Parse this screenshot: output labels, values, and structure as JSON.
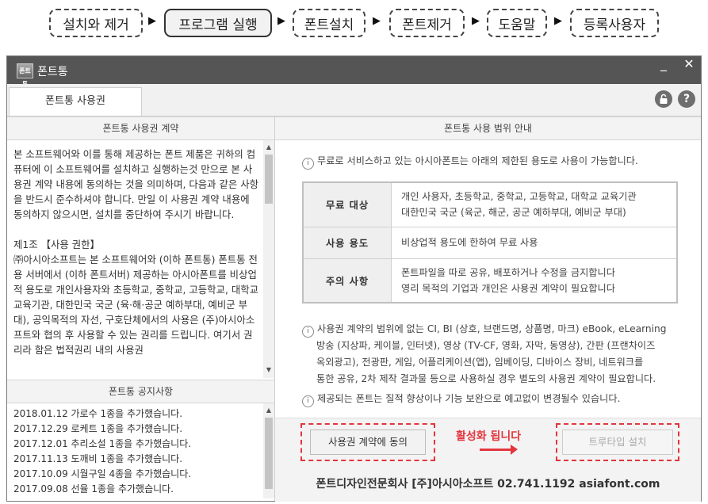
{
  "steps": [
    "설치와 제거",
    "프로그램 실행",
    "폰트설치",
    "폰트제거",
    "도움말",
    "등록사용자"
  ],
  "active_step": "프로그램 실행",
  "window": {
    "icon_text": "폰트통",
    "title": "폰트통",
    "minimize_glyph": "_",
    "close_glyph": "✕"
  },
  "tab": {
    "label": "폰트통 사용권"
  },
  "left": {
    "license_header": "폰트통 사용권 계약",
    "license_paragraphs": [
      "본 소프트웨어와 이를 통해 제공하는 폰트 제품은 귀하의 컴퓨터에 이 소프트웨어를 설치하고 실행하는것 만으로 본 사용권 계약 내용에 동의하는 것을 의미하며, 다음과 같은 사항을 반드시 준수하셔야 합니다. 만일 이 사용권 계약 내용에 동의하지 않으시면, 설치를 중단하여 주시기 바랍니다.",
      "제1조 【사용 권한】\n㈜아시아소프트는 본 소프트웨어와 (이하 폰트통) 폰트통 전용 서버에서 (이하 폰트서버) 제공하는 아시아폰트를 비상업적 용도로 개인사용자와 초등학교, 중학교, 고등학교, 대학교 교육기관, 대한민국 국군 (육·해·공군 예하부대, 예비군 부대), 공익목적의 자선, 구호단체에서의 사용은 (주)아시아소프트와 협의 후 사용할 수 있는 권리를 드립니다. 여기서 권리라 함은 법적권리 내의 사용권"
    ],
    "notice_header": "폰트통 공지사항",
    "notices": [
      "2018.01.12 가로수 1종을 추가했습니다.",
      "2017.12.29 로케트 1종을 추가했습니다.",
      "2017.12.01 추리소설 1종을 추가했습니다.",
      "2017.11.13 도깨비 1종을 추가했습니다.",
      "2017.10.09 시월구일 4종을 추가했습니다.",
      "2017.09.08 선율 1종을 추가했습니다."
    ]
  },
  "right": {
    "header": "폰트통 사용 범위 안내",
    "intro": "무료로 서비스하고 있는 아시아폰트는 아래의 제한된 용도로 사용이 가능합니다.",
    "table": [
      {
        "key": "무료 대상",
        "lines": [
          "개인 사용자, 초등학교, 중학교, 고등학교, 대학교 교육기관",
          "대한민국 국군 (육군, 해군, 공군 예하부대, 예비군 부대)"
        ]
      },
      {
        "key": "사용 용도",
        "lines": [
          "비상업적 용도에 한하여 무료 사용"
        ]
      },
      {
        "key": "주의 사항",
        "lines": [
          "폰트파일을 따로 공유, 배포하거나 수정을 금지합니다",
          "영리 목적의 기업과 개인은 사용권 계약이 필요합니다"
        ]
      }
    ],
    "note1_lines": [
      "사용권 계약의 범위에 없는 CI, BI (상호, 브랜드명, 상품명, 마크) eBook, eLearning",
      "방송 (지상파, 케이블, 인터넷), 영상 (TV-CF, 영화, 자막, 동영상), 간판 (프랜차이즈",
      "옥외광고), 전광판, 게임, 어플리케이션(앱), 임베이딩, 디바이스 장비, 네트워크를",
      "통한 공유, 2차 제작 결과물 등으로 사용하실 경우 별도의 사용권 계약이 필요합니다."
    ],
    "note2": "제공되는 폰트는 질적 향상이나 기능 보완으로 예고없이 변경될수 있습니다.",
    "agree_button": "사용권 계약에 동의",
    "activate_label": "활성화 됩니다",
    "install_button": "트루타입 설치",
    "company": "폰트디자인전문회사 [주]아시아소프트  02.741.1192  asiafont.com"
  },
  "colors": {
    "accent_red": "#e4353d",
    "titlebar": "#555555"
  }
}
